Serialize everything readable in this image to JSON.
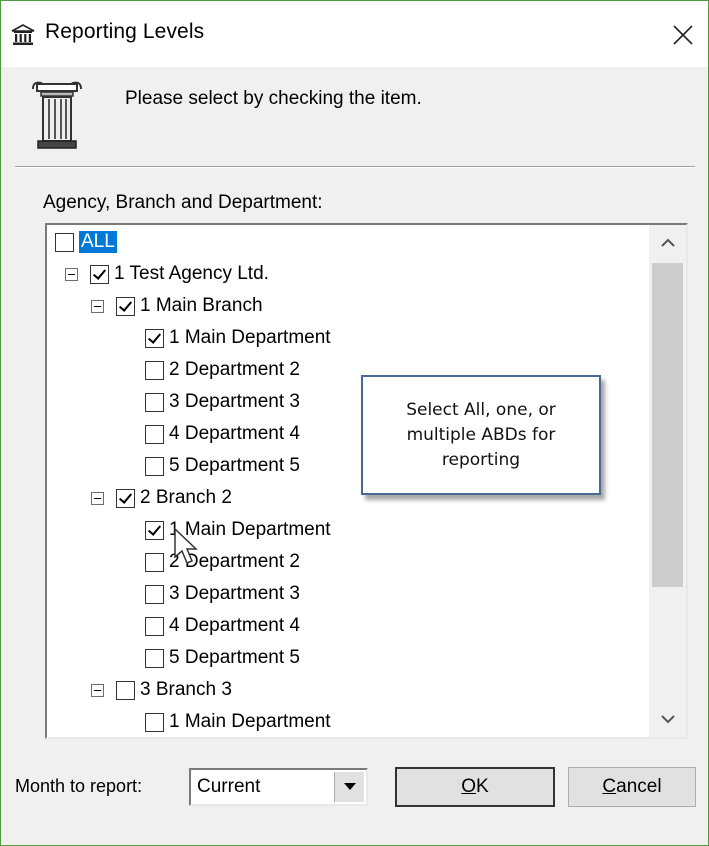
{
  "window": {
    "title": "Reporting Levels",
    "close_symbol": "✕",
    "title_icon": "bank-icon",
    "header_icon": "ionic-column-icon"
  },
  "instruction": "Please select by checking the item.",
  "tree": {
    "label": "Agency, Branch and Department:",
    "items": [
      {
        "text": "ALL",
        "checked": false,
        "level": 0,
        "selected": true
      },
      {
        "text": "1 Test Agency Ltd.",
        "checked": true,
        "level": 1,
        "expander": true
      },
      {
        "text": "1 Main Branch",
        "checked": true,
        "level": 2,
        "expander": true
      },
      {
        "text": "1 Main Department",
        "checked": true,
        "level": 3
      },
      {
        "text": "2 Department 2",
        "checked": false,
        "level": 3
      },
      {
        "text": "3 Department 3",
        "checked": false,
        "level": 3
      },
      {
        "text": "4 Department 4",
        "checked": false,
        "level": 3
      },
      {
        "text": "5 Department 5",
        "checked": false,
        "level": 3
      },
      {
        "text": "2 Branch 2",
        "checked": true,
        "level": 2,
        "expander": true
      },
      {
        "text": "1 Main Department",
        "checked": true,
        "level": 3
      },
      {
        "text": "2 Department 2",
        "checked": false,
        "level": 3
      },
      {
        "text": "3 Department 3",
        "checked": false,
        "level": 3
      },
      {
        "text": "4 Department 4",
        "checked": false,
        "level": 3
      },
      {
        "text": "5 Department 5",
        "checked": false,
        "level": 3
      },
      {
        "text": "3 Branch 3",
        "checked": false,
        "level": 2,
        "expander": true
      },
      {
        "text": "1 Main Department",
        "checked": false,
        "level": 3
      }
    ]
  },
  "callout": {
    "line1": "Select All, one, or",
    "line2": "multiple ABDs for",
    "line3": "reporting"
  },
  "footer": {
    "month_label": "Month to report:",
    "month_value": "Current",
    "ok_mnemonic": "O",
    "ok_rest": "K",
    "cancel_mnemonic": "C",
    "cancel_rest": "ancel"
  }
}
